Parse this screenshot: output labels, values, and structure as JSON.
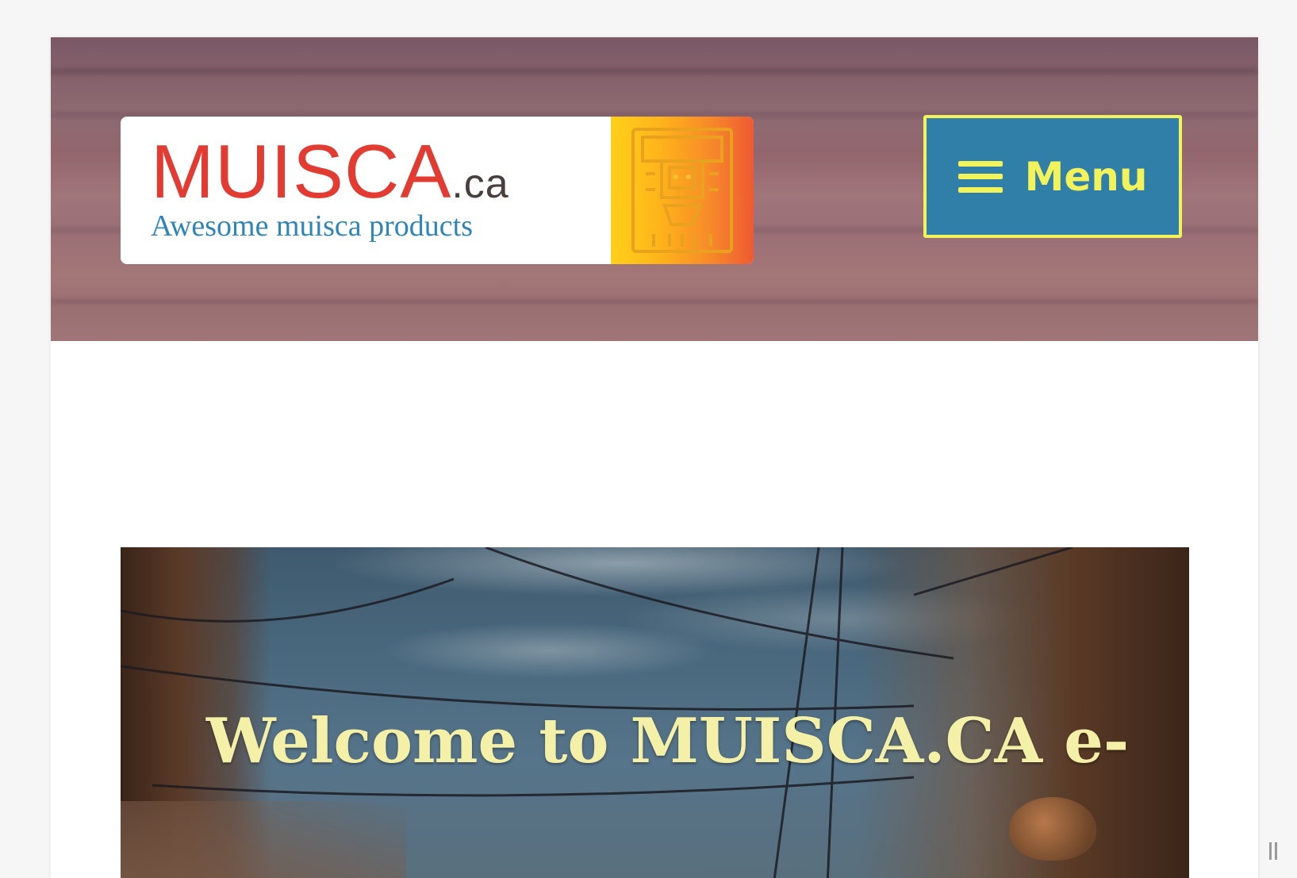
{
  "header": {
    "logo": {
      "wordmark": "MUISCA",
      "domain": ".ca",
      "tagline": "Awesome muisca products",
      "emblem_icon": "muisca-figure-icon"
    },
    "menu_button": {
      "icon": "hamburger-icon",
      "label": "Menu"
    }
  },
  "hero": {
    "title": "Welcome to MUISCA.CA e-"
  },
  "colors": {
    "logo_red": "#e23b32",
    "tagline_blue": "#2e86b8",
    "menu_bg": "#2f7fa8",
    "menu_accent": "#f2f25a",
    "hero_title": "#f4f0a8"
  }
}
